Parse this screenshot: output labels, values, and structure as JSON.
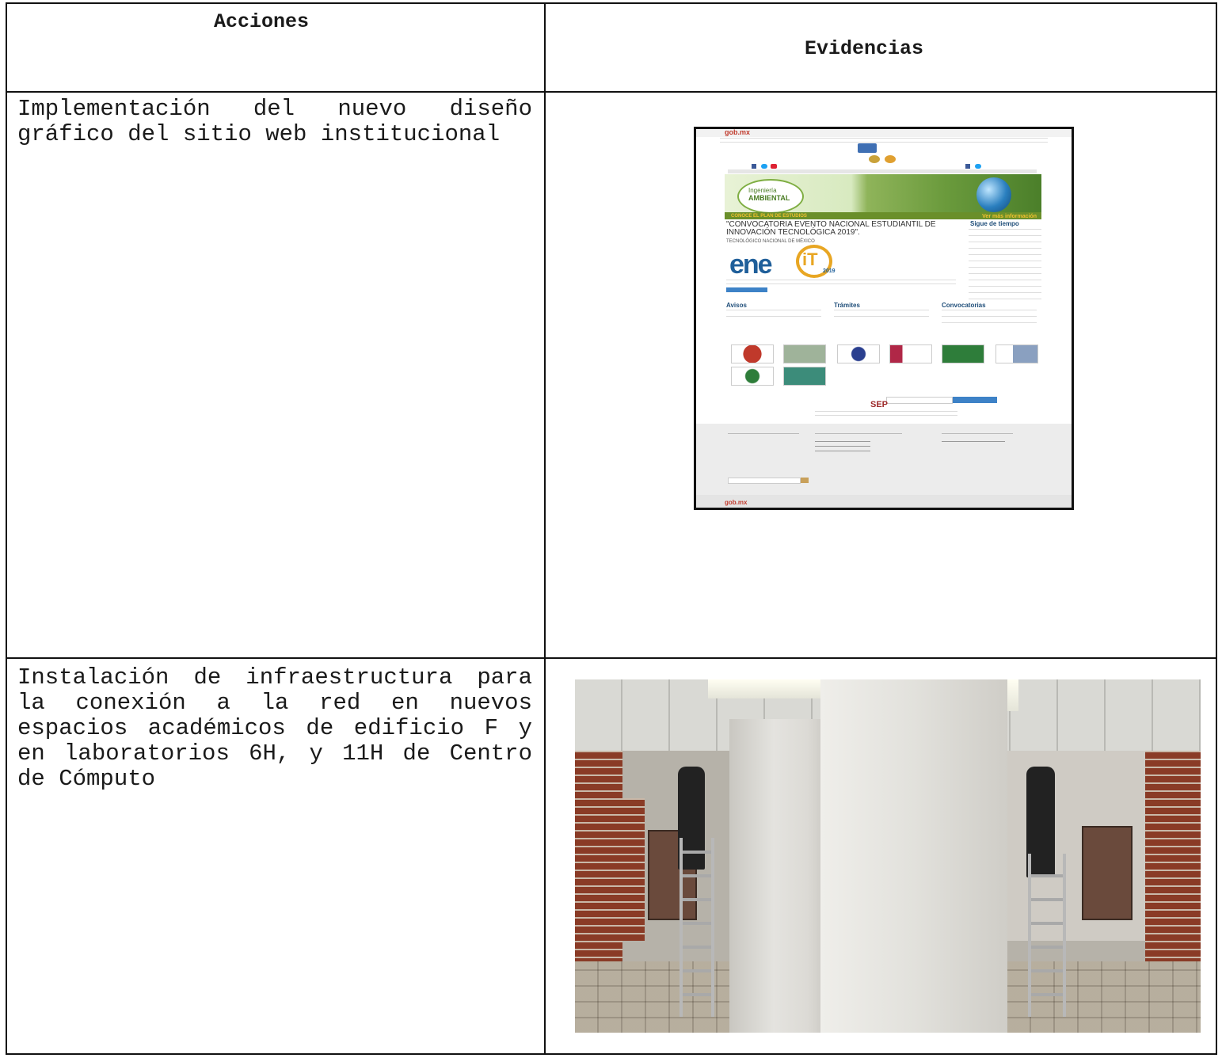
{
  "table": {
    "header": {
      "acciones": "Acciones",
      "evidencias": "Evidencias"
    },
    "rows": [
      {
        "accion": "Implementación del nuevo diseño gráfico del sitio web institucional",
        "evidencia_type": "website-screenshot"
      },
      {
        "accion": "Instalación de infraestructura para la conexión a la red en nuevos espacios académicos de edificio F y en laboratorios 6H, y 11H de Centro de Cómputo",
        "evidencia_type": "hallway-photo"
      }
    ]
  },
  "screenshot": {
    "gob_logo": "gob.mx",
    "banner_line1": "Ingeniería",
    "banner_line2": "AMBIENTAL",
    "banner_left": "CONOCE EL PLAN DE ESTUDIOS",
    "banner_right": "Ver más información",
    "headline": "\"CONVOCATORIA EVENTO NACIONAL ESTUDIANTIL DE INNOVACIÓN TECNOLÓGICA 2019\".",
    "subhead": "TECNOLÓGICO NACIONAL DE MÉXICO",
    "sidebar_title": "Sigue de tiempo",
    "ene_logo": "ene",
    "ene_logo_it": "iT",
    "ene_year": "2019",
    "section_avisos": "Avisos",
    "section_tramites": "Trámites",
    "section_convocatorias": "Convocatorias",
    "sep_logo": "SEP",
    "footer_logo": "gob.mx"
  }
}
